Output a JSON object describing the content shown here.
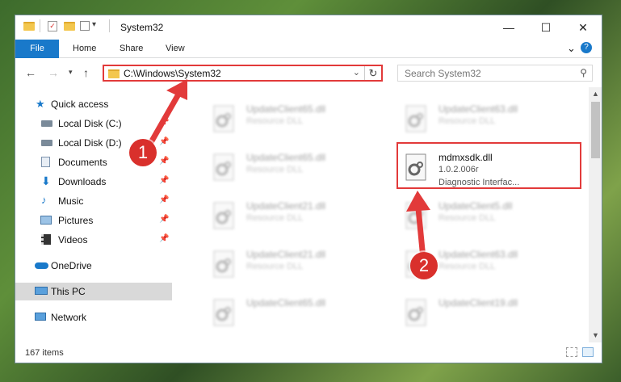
{
  "window": {
    "title": "System32",
    "controls": {
      "minimize": "—",
      "maximize": "☐",
      "close": "✕"
    }
  },
  "ribbon": {
    "tabs": [
      "File",
      "Home",
      "Share",
      "View"
    ],
    "expand": "⌄",
    "help": "?"
  },
  "address": {
    "path": "C:\\Windows\\System32",
    "dropdown": "⌄",
    "refresh": "↻"
  },
  "search": {
    "placeholder": "Search System32"
  },
  "nav": {
    "items": [
      {
        "label": "Quick access",
        "icon": "star-icon"
      },
      {
        "label": "Local Disk (C:)",
        "icon": "drive-icon",
        "pinned": true
      },
      {
        "label": "Local Disk (D:)",
        "icon": "drive-icon",
        "pinned": true
      },
      {
        "label": "Documents",
        "icon": "documents-icon",
        "pinned": true
      },
      {
        "label": "Downloads",
        "icon": "download-icon",
        "pinned": true
      },
      {
        "label": "Music",
        "icon": "music-icon",
        "pinned": true
      },
      {
        "label": "Pictures",
        "icon": "pictures-icon",
        "pinned": true
      },
      {
        "label": "Videos",
        "icon": "videos-icon",
        "pinned": true
      },
      {
        "label": "OneDrive",
        "icon": "cloud-icon"
      },
      {
        "label": "This PC",
        "icon": "computer-icon",
        "selected": true
      },
      {
        "label": "Network",
        "icon": "network-icon"
      }
    ]
  },
  "files": [
    {
      "name": "UpdateClient65.dll",
      "type": "Resource DLL"
    },
    {
      "name": "UpdateClient63.dll",
      "type": "Resource DLL"
    },
    {
      "name": "UpdateClient65.dll",
      "type": "Resource DLL"
    },
    {
      "name": "mdmxsdk.dll",
      "version": "1.0.2.006r",
      "description": "Diagnostic Interfac..."
    },
    {
      "name": "UpdateClient21.dll",
      "type": "Resource DLL"
    },
    {
      "name": "UpdateClient5.dll",
      "type": "Resource DLL"
    },
    {
      "name": "UpdateClient21.dll",
      "type": "Resource DLL"
    },
    {
      "name": "UpdateClient63.dll",
      "type": "Resource DLL"
    },
    {
      "name": "UpdateClient65.dll",
      "type": "Resource DLL"
    },
    {
      "name": "UpdateClient19.dll",
      "type": "Resource DLL"
    }
  ],
  "status": {
    "item_count": "167 items"
  },
  "callouts": {
    "one": "1",
    "two": "2"
  },
  "colors": {
    "accent": "#1979ca",
    "highlight": "#e23a3a",
    "badge": "#d9302c"
  }
}
